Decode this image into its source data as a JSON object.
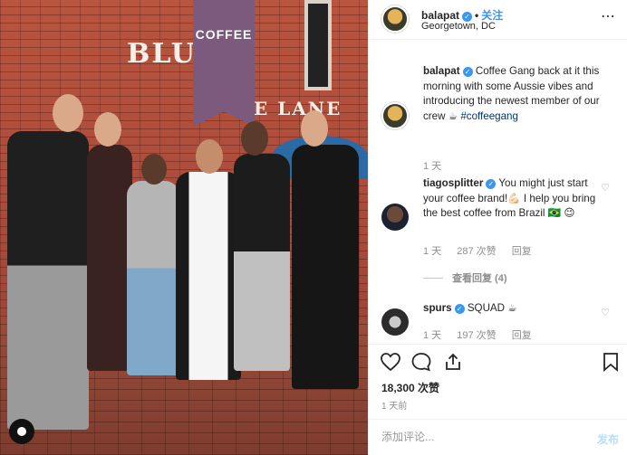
{
  "photo": {
    "sign_text_1": "BLUE",
    "sign_text_2": "E LANE",
    "flag_text": "COFFEE"
  },
  "header": {
    "username": "balapat",
    "verified_mark": "✓",
    "separator": "•",
    "follow_label": "关注",
    "location": "Georgetown, DC",
    "more_glyph": "⋯"
  },
  "comments": [
    {
      "username": "balapat",
      "verified_mark": "✓",
      "text": "Coffee Gang back at it this morning with some Aussie vibes and introducing the newest member of our crew ☕",
      "hashtag": "#coffeegang",
      "time": "1 天"
    },
    {
      "username": "tiagosplitter",
      "verified_mark": "✓",
      "text": "You might just start your coffee brand!💪🏻 I help you bring the best coffee from Brazil 🇧🇷 😉",
      "time": "1 天",
      "likes": "287 次赞",
      "reply_label": "回复",
      "view_replies": "查看回复 (4)",
      "heart_glyph": "♡"
    },
    {
      "username": "spurs",
      "verified_mark": "✓",
      "text": "SQUAD ☕",
      "time": "1 天",
      "likes": "197 次赞",
      "reply_label": "回复",
      "heart_glyph": "♡"
    }
  ],
  "actions": {
    "like_icon": "heart-outline",
    "comment_icon": "speech-bubble",
    "share_icon": "share-arrow",
    "save_icon": "bookmark"
  },
  "likes_count": "18,300 次赞",
  "posted_ago": "1 天前",
  "add_comment": {
    "placeholder": "添加评论...",
    "post_label": "发布"
  }
}
